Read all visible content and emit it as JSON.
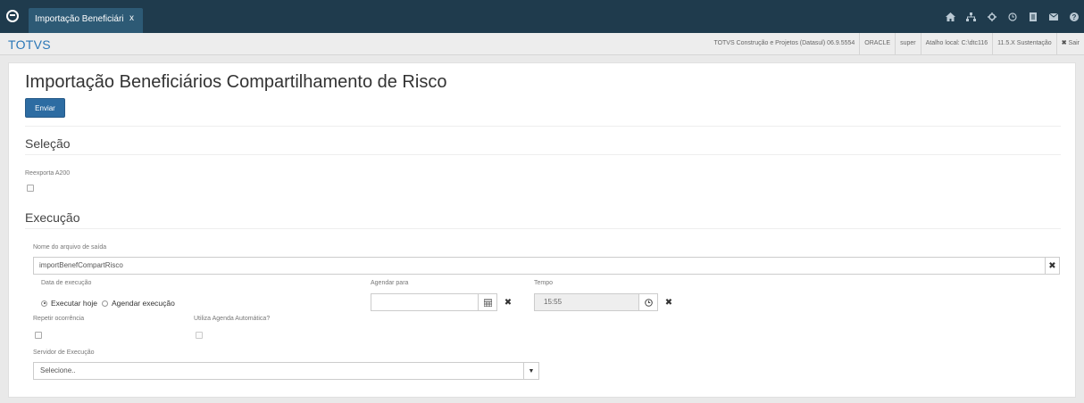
{
  "topbar": {
    "tab_label": "Importação Beneficiári",
    "tab_close": "x",
    "icons": [
      "home-icon",
      "sitemap-icon",
      "gear-icon",
      "clock-icon",
      "document-icon",
      "mail-icon",
      "help-icon"
    ]
  },
  "subbar": {
    "brand": "TOTVS",
    "company": "TOTVS Construção e Projetos (Datasul) 06.9.5554",
    "database": "ORACLE",
    "user": "super",
    "shortcut": "Atalho local: C:\\dtc116",
    "version": "11.5.X Sustentação",
    "logout_icon": "✖",
    "logout": "Sair"
  },
  "page": {
    "title": "Importação Beneficiários Compartilhamento de Risco",
    "submit_label": "Enviar"
  },
  "selecao": {
    "title": "Seleção",
    "reexporta_label": "Reexporta A200"
  },
  "execucao": {
    "title": "Execução",
    "output_file_label": "Nome do arquivo de saída",
    "output_file_value": "importBenefCompartRisco",
    "exec_date_label": "Data de execução",
    "option_today": "Executar hoje",
    "option_schedule": "Agendar execução",
    "schedule_label": "Agendar para",
    "schedule_value": "",
    "time_label": "Tempo",
    "time_value": "15:55",
    "repeat_label": "Repetir ocorrência",
    "auto_agenda_label": "Utiliza Agenda Automática?",
    "server_label": "Servidor de Execução",
    "server_placeholder": "Selecione.."
  },
  "colors": {
    "topbar": "#1f3b4d",
    "tab": "#2d5a75",
    "brand": "#2a77b7",
    "primary_button": "#2d6ca2"
  }
}
